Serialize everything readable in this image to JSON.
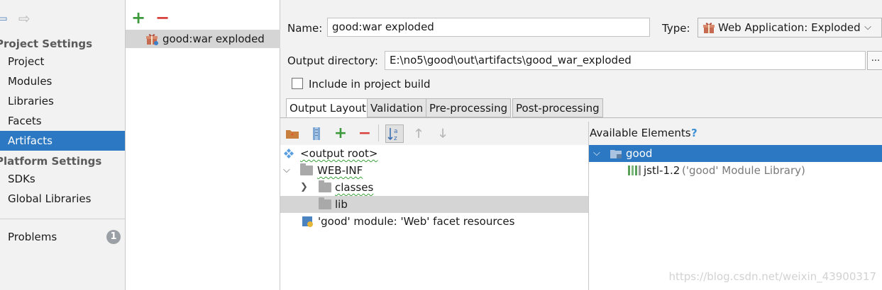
{
  "sidebar": {
    "project_settings_header": "Project Settings",
    "project_items": [
      "Project",
      "Modules",
      "Libraries",
      "Facets",
      "Artifacts"
    ],
    "selected": "Artifacts",
    "platform_settings_header": "Platform Settings",
    "platform_items": [
      "SDKs",
      "Global Libraries"
    ],
    "problems_label": "Problems",
    "problems_count": "1"
  },
  "artifact_list": {
    "items": [
      "good:war exploded"
    ]
  },
  "form": {
    "name_label": "Name:",
    "name_value": "good:war exploded",
    "type_label": "Type:",
    "type_value": "Web Application: Exploded",
    "output_dir_label": "Output directory:",
    "output_dir_value": "E:\\no5\\good\\out\\artifacts\\good_war_exploded",
    "browse_label": "...",
    "include_build_label": "Include in project build"
  },
  "tabs": [
    "Output Layout",
    "Validation",
    "Pre-processing",
    "Post-processing"
  ],
  "layout_tree": {
    "root": "<output root>",
    "web_inf": "WEB-INF",
    "classes": "classes",
    "lib": "lib",
    "facet_resources": "'good' module: 'Web' facet resources"
  },
  "available_elements": {
    "title": "Available Elements",
    "help": "?",
    "module": "good",
    "library_name": "jstl-1.2",
    "library_detail": "('good' Module Library)"
  },
  "watermark": "https://blog.csdn.net/weixin_43900317",
  "colors": {
    "selection_blue": "#2d78c2",
    "add_green": "#3c9a3c",
    "remove_red": "#d8413c"
  }
}
